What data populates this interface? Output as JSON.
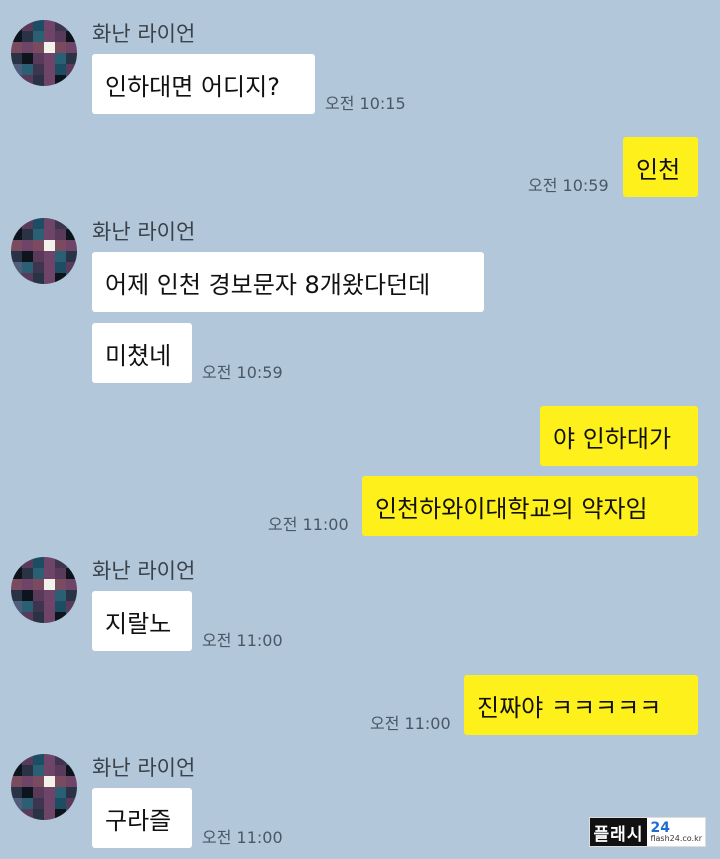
{
  "messages": [
    {
      "sender": "화난 라이언",
      "text": "인하대면 어디지?",
      "time": "오전 10:15"
    },
    {
      "text": "인천",
      "time": "오전 10:59"
    },
    {
      "sender": "화난 라이언",
      "text": "어제 인천 경보문자 8개왔다던데"
    },
    {
      "text": "미쳤네",
      "time": "오전 10:59"
    },
    {
      "text": "야 인하대가"
    },
    {
      "text": "인천하와이대학교의 약자임",
      "time": "오전 11:00"
    },
    {
      "sender": "화난 라이언",
      "text": "지랄노",
      "time": "오전 11:00"
    },
    {
      "text": "진짜야 ㅋㅋㅋㅋㅋ",
      "time": "오전 11:00"
    },
    {
      "sender": "화난 라이언",
      "text": "구라즐",
      "time": "오전 11:00"
    }
  ],
  "watermark": {
    "brand": "플래시",
    "num": "24",
    "site": "flash24.co.kr"
  }
}
